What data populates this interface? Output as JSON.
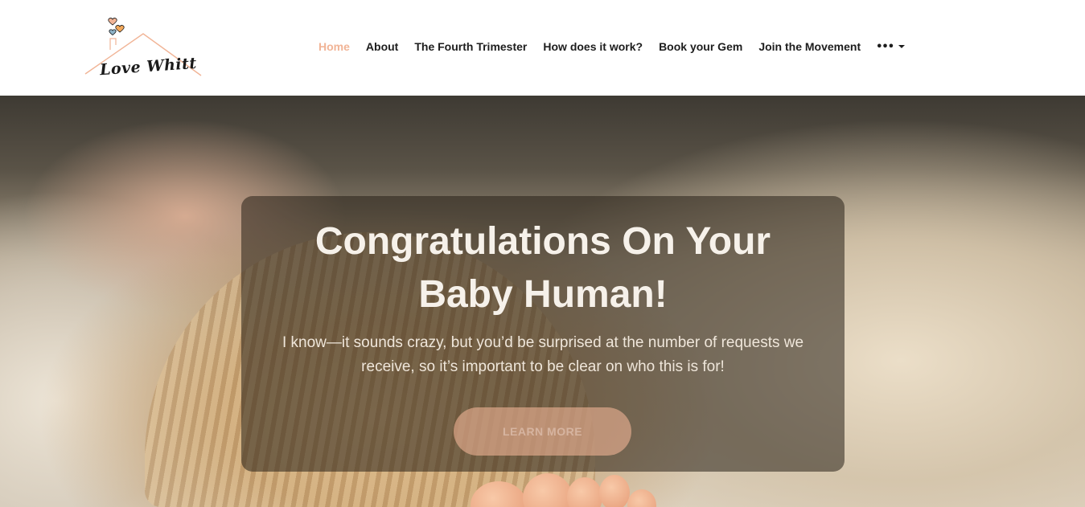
{
  "brand": {
    "logo_text": "Love Whitt",
    "accent_color": "#f1b496"
  },
  "nav": {
    "items": [
      {
        "label": "Home",
        "active": true
      },
      {
        "label": "About",
        "active": false
      },
      {
        "label": "The Fourth Trimester",
        "active": false
      },
      {
        "label": "How does it work?",
        "active": false
      },
      {
        "label": "Book your Gem",
        "active": false
      },
      {
        "label": "Join the Movement",
        "active": false
      }
    ],
    "more_icon": "ellipsis-dropdown-icon",
    "more_label": "•••"
  },
  "hero": {
    "title_line1": "Congratulations On Your",
    "title_line2": "Baby Human!",
    "subtitle_line1": "I know—it sounds crazy, but you’d be surprised at the number of requests we",
    "subtitle_line2": "receive, so it’s important to be clear on who this is for!",
    "cta_label": "LEARN MORE"
  }
}
